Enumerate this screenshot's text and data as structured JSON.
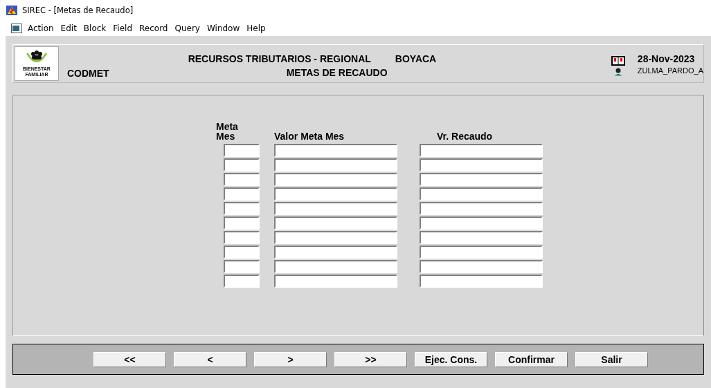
{
  "window": {
    "title": "SIREC - [Metas de Recaudo]"
  },
  "menu": [
    "Action",
    "Edit",
    "Block",
    "Field",
    "Record",
    "Query",
    "Window",
    "Help"
  ],
  "header": {
    "logo_text": [
      "BIENESTAR",
      "FAMILIAR"
    ],
    "form_code": "CODMET",
    "title_line1": "RECURSOS TRIBUTARIOS - REGIONAL",
    "region": "BOYACA",
    "title_line2": "METAS DE RECAUDO",
    "date": "28-Nov-2023",
    "user": "ZULMA_PARDO_A"
  },
  "table": {
    "columns": [
      [
        "Meta",
        "Mes"
      ],
      [
        "Valor Meta Mes"
      ],
      [
        "Vr. Recaudo"
      ]
    ],
    "rows": [
      {
        "kind": "blank"
      },
      {
        "kind": "blank"
      },
      {
        "kind": "blank"
      },
      {
        "kind": "blank"
      },
      {
        "kind": "blank"
      },
      {
        "kind": "blank"
      },
      {
        "kind": "blank"
      },
      {
        "kind": "blank"
      },
      {
        "kind": "blank"
      },
      {
        "kind": "blank"
      }
    ]
  },
  "buttons": [
    "<<",
    "<",
    ">",
    ">>",
    "Ejec. Cons.",
    "Confirmar",
    "Salir"
  ]
}
